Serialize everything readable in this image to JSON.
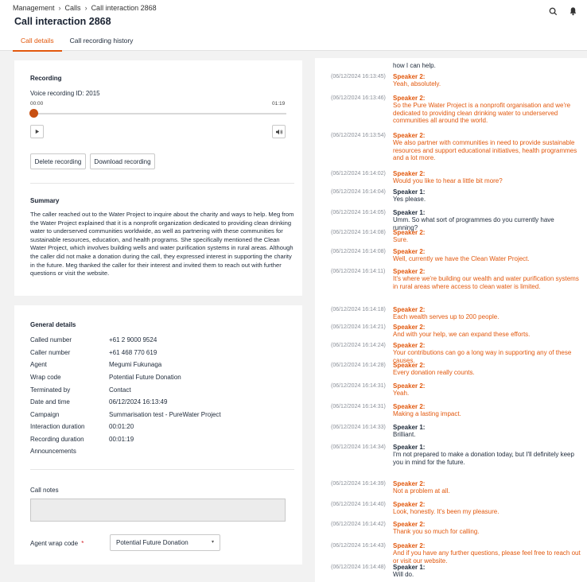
{
  "breadcrumb": {
    "items": [
      "Management",
      "Calls",
      "Call interaction 2868"
    ]
  },
  "page_title": "Call interaction 2868",
  "tabs": [
    {
      "label": "Call details",
      "active": true
    },
    {
      "label": "Call recording history",
      "active": false
    }
  ],
  "recording": {
    "title": "Recording",
    "voice_id": "Voice recording ID: 2015",
    "time_start": "00:00",
    "time_end": "01:19",
    "progress": 0.0,
    "delete_label": "Delete recording",
    "download_label": "Download recording"
  },
  "summary": {
    "title": "Summary",
    "text": "The caller reached out to the Water Project to inquire about the charity and ways to help. Meg from the Water Project explained that it is a nonprofit organization dedicated to providing clean drinking water to underserved communities worldwide, as well as partnering with these communities for sustainable resources, education, and health programs. She specifically mentioned the Clean Water Project, which involves building wells and water purification systems in rural areas. Although the caller did not make a donation during the call, they expressed interest in supporting the charity in the future. Meg thanked the caller for their interest and invited them to reach out with further questions or visit the website."
  },
  "general": {
    "title": "General details",
    "rows": [
      {
        "key": "Called number",
        "value": "+61 2 9000 9524"
      },
      {
        "key": "Caller number",
        "value": "+61 468 770 619"
      },
      {
        "key": "Agent",
        "value": "Megumi Fukunaga"
      },
      {
        "key": "Wrap code",
        "value": "Potential Future Donation"
      },
      {
        "key": "Terminated by",
        "value": "Contact"
      },
      {
        "key": "Date and time",
        "value": "06/12/2024 16:13:49"
      },
      {
        "key": "Campaign",
        "value": "Summarisation test - PureWater Project"
      },
      {
        "key": "Interaction duration",
        "value": "00:01:20"
      },
      {
        "key": "Recording duration",
        "value": "00:01:19"
      },
      {
        "key": "Announcements",
        "value": ""
      }
    ]
  },
  "notes": {
    "title": "Call notes",
    "value": "",
    "wrap_label": "Agent wrap code",
    "required_mark": "*",
    "wrap_value": "Potential Future Donation"
  },
  "transcript": {
    "top_fragment": "how I can help.",
    "entries": [
      {
        "ts": "(06/12/2024 16:13:45)",
        "speaker": "Speaker 2:",
        "text": "Yeah, absolutely.",
        "color": "orange"
      },
      {
        "ts": "(06/12/2024 16:13:46)",
        "speaker": "Speaker 2:",
        "text": "So the Pure Water Project is a nonprofit organisation and we're dedicated to providing clean drinking water to underserved communities all around the world.",
        "color": "orange"
      },
      {
        "ts": "(06/12/2024 16:13:54)",
        "speaker": "Speaker 2:",
        "text": "We also partner with communities in need to provide sustainable resources and support educational initiatives, health programmes and a lot more.",
        "color": "orange"
      },
      {
        "ts": "(06/12/2024 16:14:02)",
        "speaker": "Speaker 2:",
        "text": "Would you like to hear a little bit more?",
        "color": "orange"
      },
      {
        "ts": "(06/12/2024 16:14:04)",
        "speaker": "Speaker 1:",
        "text": "Yes please.",
        "color": "dark"
      },
      {
        "ts": "(06/12/2024 16:14:05)",
        "speaker": "Speaker 1:",
        "text": "Umm. So what sort of programmes do you currently have running?",
        "color": "dark"
      },
      {
        "ts": "(06/12/2024 16:14:08)",
        "speaker": "Speaker 2:",
        "text": "Sure.",
        "color": "orange"
      },
      {
        "ts": "(06/12/2024 16:14:08)",
        "speaker": "Speaker 2:",
        "text": "Well, currently we have the Clean Water Project.",
        "color": "orange"
      },
      {
        "ts": "(06/12/2024 16:14:11)",
        "speaker": "Speaker 2:",
        "text": "It's where we're building our wealth and water purification systems in rural areas where access to clean water is limited.",
        "color": "orange"
      },
      {
        "ts": "(06/12/2024 16:14:18)",
        "speaker": "Speaker 2:",
        "text": "Each wealth serves up to 200 people.",
        "color": "orange"
      },
      {
        "ts": "(06/12/2024 16:14:21)",
        "speaker": "Speaker 2:",
        "text": "And with your help, we can expand these efforts.",
        "color": "orange"
      },
      {
        "ts": "(06/12/2024 16:14:24)",
        "speaker": "Speaker 2:",
        "text": "Your contributions can go a long way in supporting any of these causes.",
        "color": "orange"
      },
      {
        "ts": "(06/12/2024 16:14:28)",
        "speaker": "Speaker 2:",
        "text": "Every donation really counts.",
        "color": "orange"
      },
      {
        "ts": "(06/12/2024 16:14:31)",
        "speaker": "Speaker 2:",
        "text": "Yeah.",
        "color": "orange"
      },
      {
        "ts": "(06/12/2024 16:14:31)",
        "speaker": "Speaker 2:",
        "text": "Making a lasting impact.",
        "color": "orange"
      },
      {
        "ts": "(06/12/2024 16:14:33)",
        "speaker": "Speaker 1:",
        "text": "Brilliant.",
        "color": "dark"
      },
      {
        "ts": "(06/12/2024 16:14:34)",
        "speaker": "Speaker 1:",
        "text": "I'm not prepared to make a donation today, but I'll definitely keep you in mind for the future.",
        "color": "dark"
      },
      {
        "ts": "(06/12/2024 16:14:39)",
        "speaker": "Speaker 2:",
        "text": "Not a problem at all.",
        "color": "orange"
      },
      {
        "ts": "(06/12/2024 16:14:40)",
        "speaker": "Speaker 2:",
        "text": "Look, honestly. It's been my pleasure.",
        "color": "orange"
      },
      {
        "ts": "(06/12/2024 16:14:42)",
        "speaker": "Speaker 2:",
        "text": "Thank you so much for calling.",
        "color": "orange"
      },
      {
        "ts": "(06/12/2024 16:14:43)",
        "speaker": "Speaker 2:",
        "text": "And if you have any further questions, please feel free to reach out or visit our website.",
        "color": "orange"
      },
      {
        "ts": "(06/12/2024 16:14:48)",
        "speaker": "Speaker 1:",
        "text": "Will do.",
        "color": "dark"
      }
    ]
  }
}
